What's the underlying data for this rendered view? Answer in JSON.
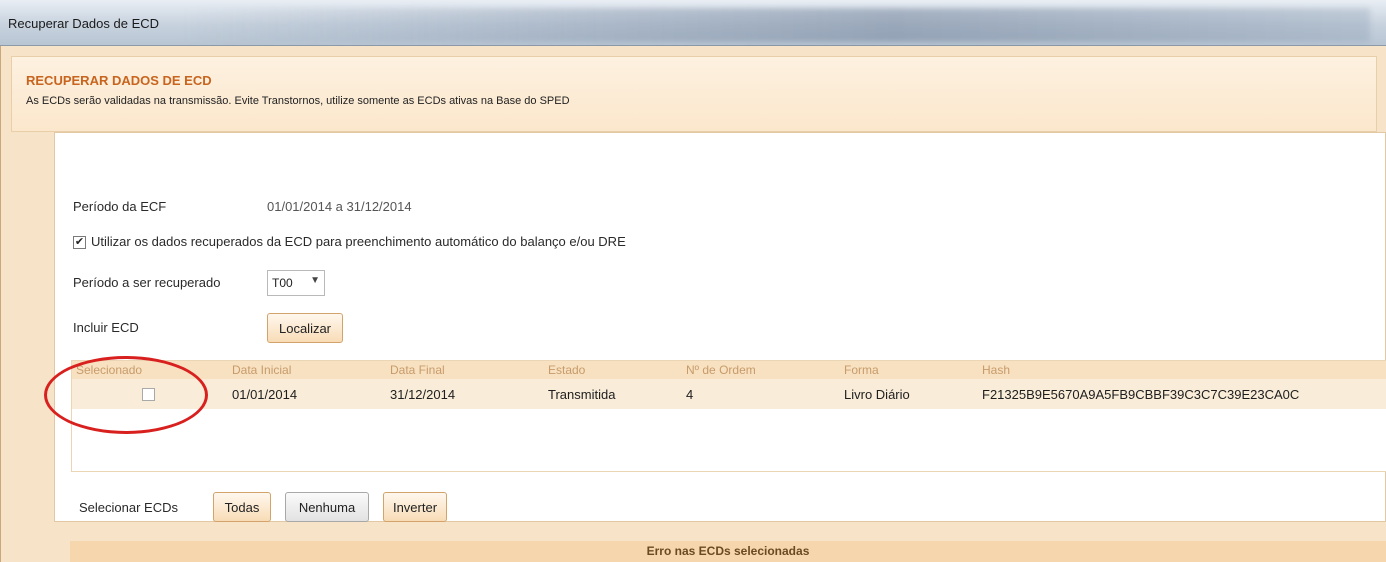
{
  "window": {
    "title": "Recuperar Dados de ECD"
  },
  "header": {
    "title": "RECUPERAR DADOS DE ECD",
    "subtitle": "As ECDs serão validadas na transmissão. Evite Transtornos, utilize somente as ECDs ativas na Base do SPED"
  },
  "form": {
    "periodo_ecf_label": "Período da ECF",
    "periodo_ecf_value": "01/01/2014 a 31/12/2014",
    "utilizar_checkbox_checked": true,
    "utilizar_label": "Utilizar os dados recuperados da ECD para preenchimento automático do balanço e/ou DRE",
    "periodo_recuperado_label": "Período a ser recuperado",
    "periodo_recuperado_value": "T00",
    "incluir_ecd_label": "Incluir ECD",
    "localizar_button": "Localizar"
  },
  "table": {
    "columns": [
      "Selecionado",
      "Data Inicial",
      "Data Final",
      "Estado",
      "Nº de Ordem",
      "Forma",
      "Hash"
    ],
    "rows": [
      {
        "selecionado": false,
        "data_inicial": "01/01/2014",
        "data_final": "31/12/2014",
        "estado": "Transmitida",
        "ordem": "4",
        "forma": "Livro Diário",
        "hash": "F21325B9E5670A9A5FB9CBBF39C3C7C39E23CA0C"
      }
    ]
  },
  "selection": {
    "label": "Selecionar ECDs",
    "todas": "Todas",
    "nenhuma": "Nenhuma",
    "inverter": "Inverter"
  },
  "errors": {
    "title": "Erro nas ECDs selecionadas"
  },
  "colors": {
    "accent_title": "#c8641e",
    "window_bg": "#f7e4c8",
    "annotation_circle": "#d8201e"
  }
}
